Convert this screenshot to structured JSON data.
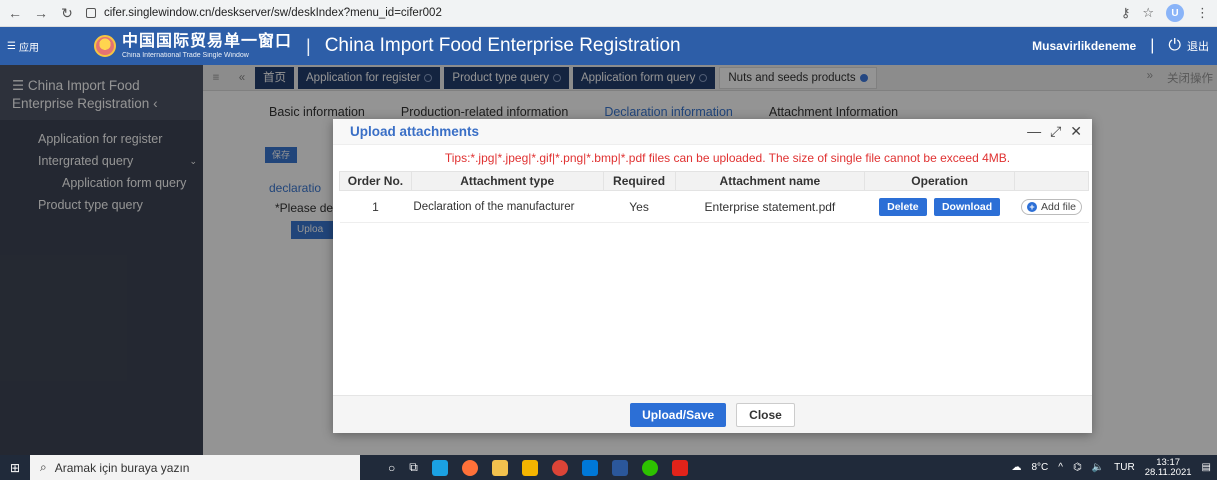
{
  "browser": {
    "url": "cifer.singlewindow.cn/deskserver/sw/deskIndex?menu_id=cifer002",
    "profile_initial": "U"
  },
  "header": {
    "apps_label": "应用",
    "logo_cn": "中国国际贸易单一窗口",
    "logo_en": "China International Trade Single Window",
    "title": "China Import Food Enterprise Registration",
    "user": "Musavirlikdeneme",
    "logout": "退出"
  },
  "sidebar": {
    "title": "China Import Food Enterprise Registration",
    "items": [
      {
        "label": "Application for register"
      },
      {
        "label": "Intergrated query"
      },
      {
        "label": "Application form query"
      },
      {
        "label": "Product type query"
      }
    ]
  },
  "tabs": {
    "home": "首页",
    "items": [
      {
        "label": "Application for register"
      },
      {
        "label": "Product type query"
      },
      {
        "label": "Application form query"
      },
      {
        "label": "Nuts and seeds products"
      }
    ],
    "close_ops": "关闭操作"
  },
  "content": {
    "sub_tabs": [
      "Basic information",
      "Production-related information",
      "Declaration information",
      "Attachment Information"
    ],
    "save": "保存",
    "declaration_label": "declaratio",
    "please": "*Please de",
    "upload": "Uploa"
  },
  "modal": {
    "title": "Upload attachments",
    "tips": "Tips:*.jpg|*.jpeg|*.gif|*.png|*.bmp|*.pdf files can be uploaded. The size of single file cannot be exceed 4MB.",
    "columns": [
      "Order No.",
      "Attachment type",
      "Required",
      "Attachment name",
      "Operation"
    ],
    "row": {
      "order": "1",
      "type": "Declaration of the manufacturer",
      "required": "Yes",
      "name": "Enterprise statement.pdf",
      "delete": "Delete",
      "download": "Download",
      "add": "Add file"
    },
    "footer": {
      "primary": "Upload/Save",
      "secondary": "Close"
    }
  },
  "taskbar": {
    "search_placeholder": "Aramak için buraya yazın",
    "temp": "8°C",
    "lang": "TUR",
    "time": "13:17",
    "date": "28.11.2021"
  },
  "colors": {
    "header": "#2d5ea8",
    "sidebar": "#3f4656",
    "accent": "#2c6fd6",
    "tips": "#e03232"
  }
}
